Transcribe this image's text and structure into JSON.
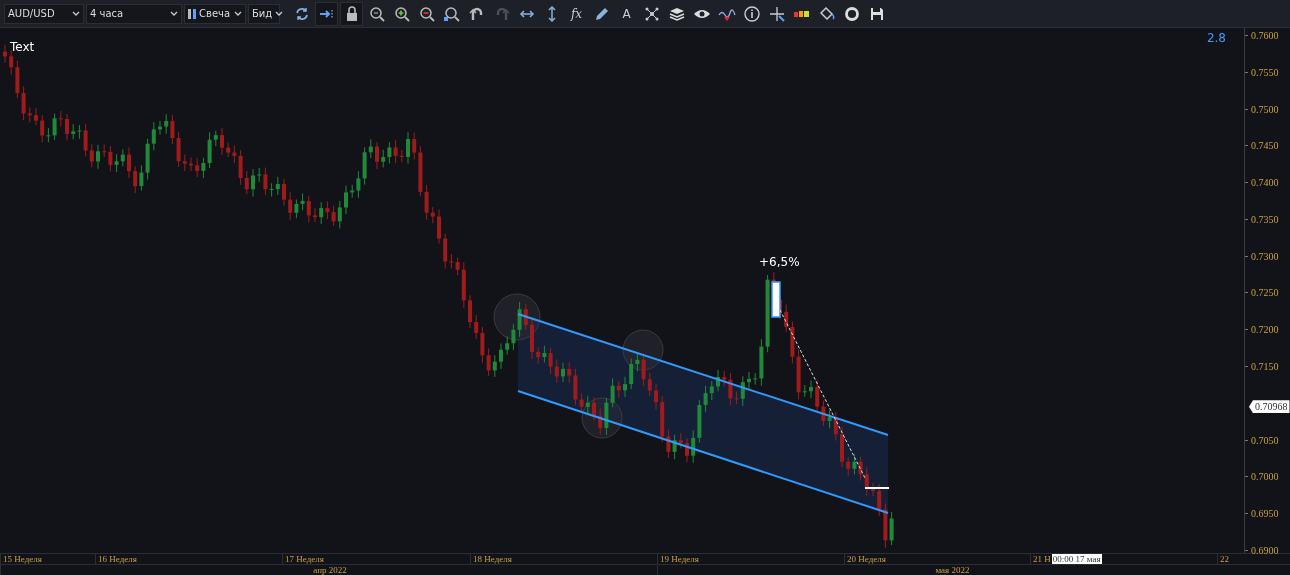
{
  "toolbar": {
    "symbol": "AUD/USD",
    "timeframe": "4 часа",
    "chart_type": "Свеча",
    "price_type": "Бид",
    "scroll_button": {
      "on": true
    },
    "lock_button": {
      "on": true
    },
    "redo_button": {
      "disabled": true
    },
    "formula_button": {
      "label": "fx"
    },
    "text_tool": {
      "label": "A"
    }
  },
  "chart": {
    "label": "Text",
    "indicator_value": "2.8",
    "annotation": "+6,5%",
    "current_price": "0.70968",
    "price_ticks": [
      "0.7600",
      "0.7550",
      "0.7500",
      "0.7450",
      "0.7400",
      "0.7350",
      "0.7300",
      "0.7250",
      "0.7200",
      "0.7150",
      "0.7050",
      "0.7000",
      "0.6950",
      "0.6900"
    ]
  },
  "time_axis": {
    "weeks": [
      "15 Неделя",
      "16 Неделя",
      "17 Неделя",
      "18 Неделя",
      "19 Неделя",
      "20 Неделя",
      "21 Н",
      "22"
    ],
    "crosshair_time": "00:00 17 мая",
    "months": [
      "апр 2022",
      "мая 2022"
    ]
  }
}
